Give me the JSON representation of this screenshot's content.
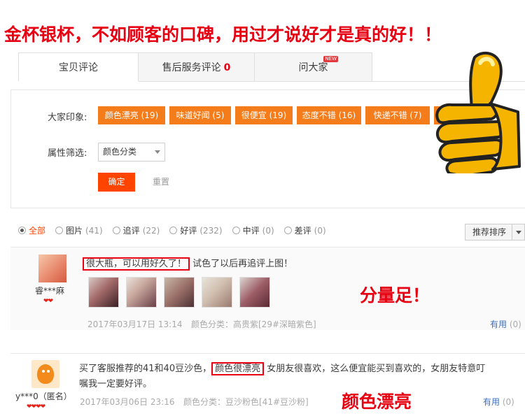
{
  "banner": "金杯银杯，不如顾客的口碑，用过才说好才是真的好！！",
  "tabs": [
    {
      "label": "宝贝评论"
    },
    {
      "label": "售后服务评论",
      "count": "0"
    },
    {
      "label": "问大家",
      "badge": "NEW"
    }
  ],
  "filters": {
    "impression_label": "大家印象:",
    "tags": [
      "颜色漂亮 (19)",
      "味道好闻 (5)",
      "很便宜 (19)",
      "态度不错 (16)",
      "快递不错 (7)"
    ],
    "attr_label": "属性筛选:",
    "attr_value": "颜色分类",
    "confirm": "确定",
    "reset": "重置"
  },
  "types": [
    {
      "label": "全部",
      "count": ""
    },
    {
      "label": "图片",
      "count": "(41)"
    },
    {
      "label": "追评",
      "count": "(22)"
    },
    {
      "label": "好评",
      "count": "(232)"
    },
    {
      "label": "中评",
      "count": "(0)"
    },
    {
      "label": "差评",
      "count": "(0)"
    }
  ],
  "sort_label": "推荐排序",
  "reviews": [
    {
      "user": "睿***麻",
      "highlight": "很大瓶，可以用好久了！",
      "text": "试色了以后再追评上图！",
      "date": "2017年03月17日 13:14",
      "sku": "颜色分类：高贵紫[29#深暗紫色]",
      "useful": "有用",
      "useful_count": "(0)",
      "annotation": "分量足！"
    },
    {
      "user": "y***0（匿名）",
      "text_pre": "买了客服推荐的41和40豆沙色，",
      "highlight": "颜色很漂亮",
      "text_post": "女朋友很喜欢，这么便宜能买到喜欢的，女朋友特意叮",
      "text_line2": "嘱我一定要好评。",
      "date": "2017年03月06日 23:16",
      "sku": "颜色分类：豆沙粉色[41#豆沙粉]",
      "useful": "有用",
      "useful_count": "(0)",
      "annotation": "颜色漂亮"
    }
  ],
  "colors": {
    "accent": "#f57c1a",
    "red": "#e60012",
    "link": "#3c6fc0"
  }
}
